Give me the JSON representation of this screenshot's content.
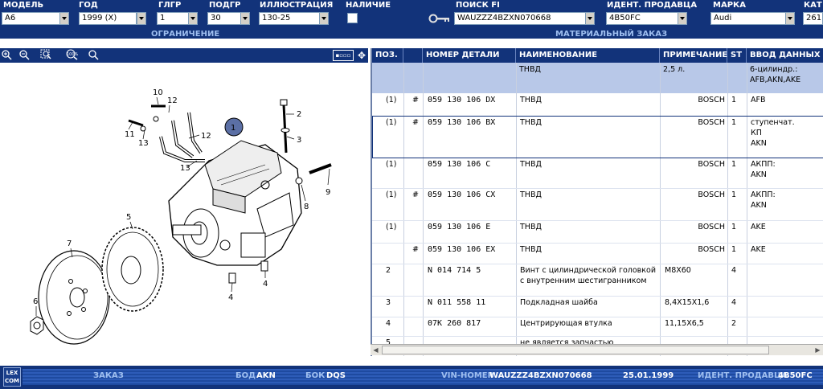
{
  "header": {
    "labels": {
      "model": "МОДЕЛЬ",
      "year": "ГОД",
      "main_group": "ГЛГР",
      "sub_group": "ПОДГР",
      "illustration": "ИЛЛЮСТРАЦИЯ",
      "availability": "НАЛИЧИЕ",
      "search_fi": "ПОИСК FI",
      "dealer_id": "ИДЕНТ. ПРОДАВЦА",
      "brand": "МАРКА",
      "cat": "КАТ"
    },
    "values": {
      "model": "A6",
      "year": "1999 (X)",
      "main_group": "1",
      "sub_group": "30",
      "illustration": "130-25",
      "search_fi": "WAUZZZ4BZXN070668",
      "dealer_id": "4B50FC",
      "brand": "Audi",
      "cat": "261"
    },
    "restriction": "ОГРАНИЧЕНИЕ",
    "material_order": "МАТЕРИАЛЬНЫЙ ЗАКАЗ"
  },
  "toolbar": {
    "icons": [
      "zoom-in-icon",
      "zoom-out-icon",
      "zoom-area-icon",
      "zoom-100-icon",
      "magnifier-icon"
    ],
    "zoom100_text": "100%",
    "view_btn": "▪▫▫▫"
  },
  "diagram": {
    "callouts": [
      "10",
      "12",
      "11",
      "13",
      "12",
      "1",
      "2",
      "3",
      "13",
      "5",
      "9",
      "8",
      "7",
      "4",
      "4",
      "6"
    ]
  },
  "table": {
    "columns": [
      "ПОЗ.",
      "",
      "НОМЕР ДЕТАЛИ",
      "НАИМЕНОВАНИЕ",
      "ПРИМЕЧАНИЕ",
      "ST",
      "ВВОД ДАННЫХ ПО"
    ],
    "summary": {
      "name": "ТНВД",
      "note": "2,5 л.",
      "input": "6-цилиндр.:\nAFB,AKN,AKE"
    },
    "rows": [
      {
        "pos": "(1)",
        "mark": "#",
        "part": "059  130  106  DX",
        "name": "ТНВД",
        "brand": "BOSCH",
        "note": "",
        "st": "1",
        "input": "AFB"
      },
      {
        "pos": "(1)",
        "mark": "#",
        "part": "059  130  106  BX",
        "name": "ТНВД",
        "brand": "BOSCH",
        "note": "",
        "st": "1",
        "input": "ступенчат.\nКП\nAKN"
      },
      {
        "pos": "(1)",
        "mark": "",
        "part": "059  130  106  C",
        "name": "ТНВД",
        "brand": "BOSCH",
        "note": "",
        "st": "1",
        "input": "АКПП:\nAKN"
      },
      {
        "pos": "(1)",
        "mark": "#",
        "part": "059  130  106  CX",
        "name": "ТНВД",
        "brand": "BOSCH",
        "note": "",
        "st": "1",
        "input": "АКПП:\nAKN"
      },
      {
        "pos": "(1)",
        "mark": "",
        "part": "059  130  106  E",
        "name": "ТНВД",
        "brand": "BOSCH",
        "note": "",
        "st": "1",
        "input": "AKE"
      },
      {
        "pos": "",
        "mark": "#",
        "part": "059  130  106  EX",
        "name": "ТНВД",
        "brand": "BOSCH",
        "note": "",
        "st": "1",
        "input": "AKE"
      },
      {
        "pos": "2",
        "mark": "",
        "part": "N     014  714  5",
        "name": "Винт с цилиндрической головкой\nс внутренним шестигранником",
        "brand": "",
        "note": "M8X60",
        "st": "4",
        "input": ""
      },
      {
        "pos": "3",
        "mark": "",
        "part": "N     011  558  11",
        "name": "Подкладная шайба",
        "brand": "",
        "note": "8,4X15X1,6",
        "st": "4",
        "input": ""
      },
      {
        "pos": "4",
        "mark": "",
        "part": "07K  260  817",
        "name": "Центрирующая втулка",
        "brand": "",
        "note": "11,15X6,5",
        "st": "2",
        "input": ""
      },
      {
        "pos": "5",
        "mark": "",
        "part": "",
        "name": "не является запчастью",
        "brand": "",
        "note": "",
        "st": "",
        "input": ""
      }
    ]
  },
  "footer": {
    "logo": "LEX\nCOM",
    "order_label": "ЗАКАЗ",
    "bod_label": "БОД",
    "bod_value": "AKN",
    "bok_label": "БОК",
    "bok_value": "DQS",
    "vin_label": "VIN-НОМЕР",
    "vin_value": "WAUZZZ4BZXN070668",
    "date": "25.01.1999",
    "dealer_label": "ИДЕНТ. ПРОДАВЦА",
    "dealer_value": "4B50FC"
  },
  "colors": {
    "header_bg": "#12337a",
    "accent": "#9fbff0",
    "summary_row": "#b8c8e8"
  }
}
